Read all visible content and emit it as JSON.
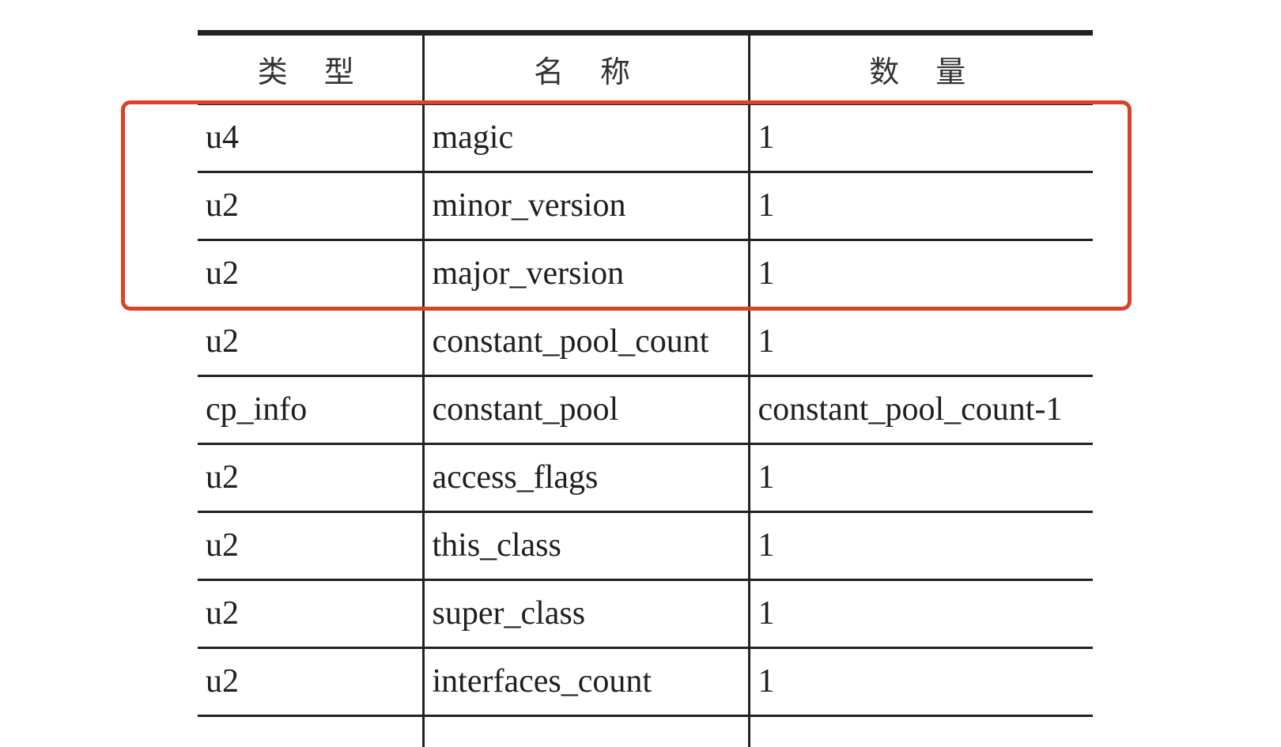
{
  "table": {
    "headers": [
      "类型",
      "名称",
      "数量"
    ],
    "rows": [
      {
        "type": "u4",
        "name": "magic",
        "count": "1"
      },
      {
        "type": "u2",
        "name": "minor_version",
        "count": "1"
      },
      {
        "type": "u2",
        "name": "major_version",
        "count": "1"
      },
      {
        "type": "u2",
        "name": "constant_pool_count",
        "count": "1"
      },
      {
        "type": "cp_info",
        "name": "constant_pool",
        "count": "constant_pool_count-1"
      },
      {
        "type": "u2",
        "name": "access_flags",
        "count": "1"
      },
      {
        "type": "u2",
        "name": "this_class",
        "count": "1"
      },
      {
        "type": "u2",
        "name": "super_class",
        "count": "1"
      },
      {
        "type": "u2",
        "name": "interfaces_count",
        "count": "1"
      }
    ]
  },
  "highlight": {
    "color": "#d8432a",
    "rows_covered": [
      "magic",
      "minor_version",
      "major_version"
    ]
  }
}
